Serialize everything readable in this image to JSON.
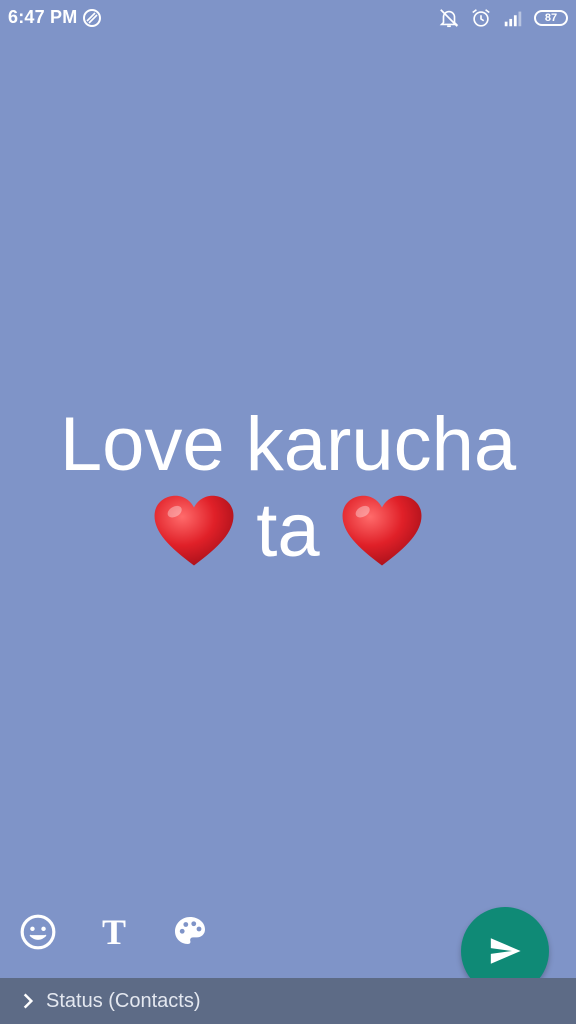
{
  "colors": {
    "background": "#7f94c8",
    "fab": "#0f8a76",
    "bottom_bar": "#5d6b86",
    "heart": "#e02028"
  },
  "status_bar": {
    "time": "6:47 PM",
    "battery": "87",
    "icons": [
      "sync-icon",
      "bell-off-icon",
      "alarm-icon",
      "signal-icon",
      "battery-icon"
    ]
  },
  "status_text": {
    "line1": "Love karucha",
    "line2_text": "ta"
  },
  "tools": {
    "text_tool_label": "T",
    "icons": [
      "emoji-icon",
      "text-tool-icon",
      "palette-icon"
    ]
  },
  "fab": {
    "icon": "send-icon"
  },
  "bottom_bar": {
    "label": "Status (Contacts)",
    "icon": "chevron-right-icon"
  }
}
